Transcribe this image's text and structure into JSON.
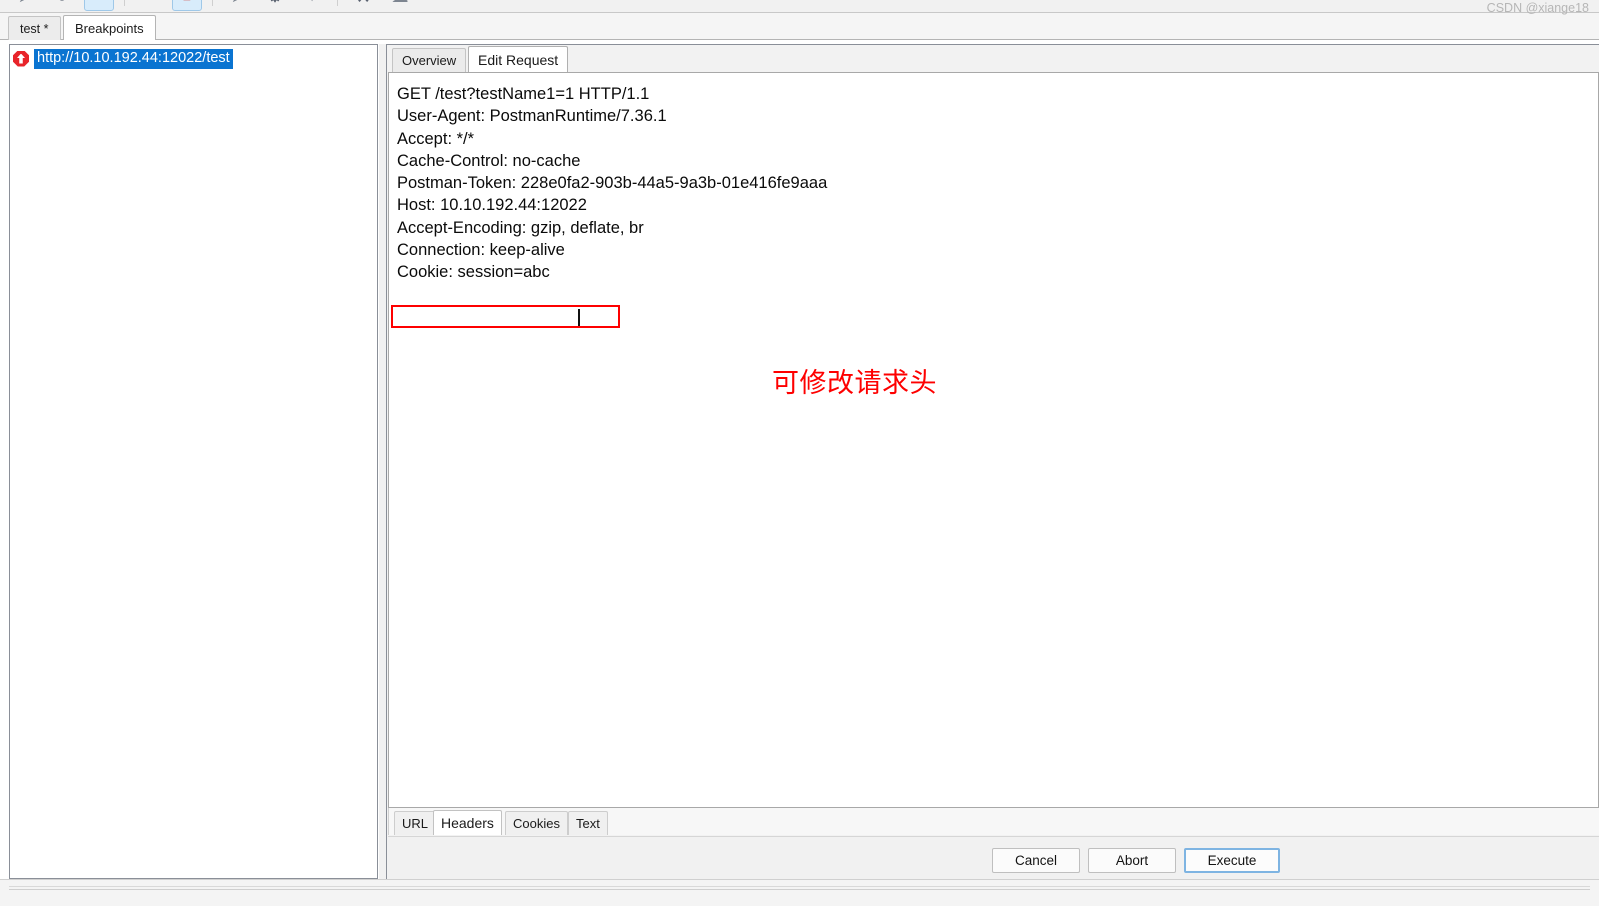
{
  "toolbar": {
    "buttons": [
      {
        "name": "forward-icon",
        "glyph": "➤",
        "selected": false
      },
      {
        "name": "record-circle-icon",
        "glyph": "●",
        "selected": false
      },
      {
        "name": "intercept-icon",
        "glyph": "▭",
        "selected": true
      },
      {
        "name": "step-icon",
        "glyph": "«",
        "selected": false
      },
      {
        "name": "breakpoint-stop-icon",
        "glyph": "■",
        "selected": true
      },
      {
        "name": "play-icon",
        "glyph": "➤",
        "selected": false
      },
      {
        "name": "settings-gear-icon",
        "glyph": "⚙",
        "selected": false
      },
      {
        "name": "chevron-down-icon",
        "glyph": "▼",
        "selected": false
      },
      {
        "name": "tools-icon",
        "glyph": "⚒",
        "selected": false
      },
      {
        "name": "cloud-icon",
        "glyph": "☁",
        "selected": false
      }
    ]
  },
  "top_tabs": [
    {
      "label": "test *",
      "active": false
    },
    {
      "label": "Breakpoints",
      "active": true
    }
  ],
  "tree": {
    "icon": "red-stop-breakpoint-icon",
    "selected_item": "http://10.10.192.44:12022/test",
    "selection_color": "#0a74d1"
  },
  "editor": {
    "tabs": [
      {
        "label": "Overview",
        "active": false
      },
      {
        "label": "Edit Request",
        "active": true
      }
    ],
    "request_lines": [
      "GET /test?testName1=1 HTTP/1.1",
      "User-Agent: PostmanRuntime/7.36.1",
      "Accept: */*",
      "Cache-Control: no-cache",
      "Postman-Token: 228e0fa2-903b-44a5-9a3b-01e416fe9aaa",
      "Host: 10.10.192.44:12022",
      "Accept-Encoding: gzip, deflate, br",
      "Connection: keep-alive",
      "Cookie: session=abc"
    ],
    "annotation": {
      "text": "可修改请求头",
      "color": "#fe0000"
    },
    "highlight_box": {
      "target_line": "Cookie: session=abc",
      "color": "#fe0000"
    },
    "bottom_tabs": [
      {
        "label": "URL",
        "active": false
      },
      {
        "label": "Headers",
        "active": true
      },
      {
        "label": "Cookies",
        "active": false
      },
      {
        "label": "Text",
        "active": false
      }
    ],
    "buttons": [
      {
        "label": "Cancel",
        "focused": false
      },
      {
        "label": "Abort",
        "focused": false
      },
      {
        "label": "Execute",
        "focused": true
      }
    ]
  },
  "watermark": "CSDN @xiange18"
}
